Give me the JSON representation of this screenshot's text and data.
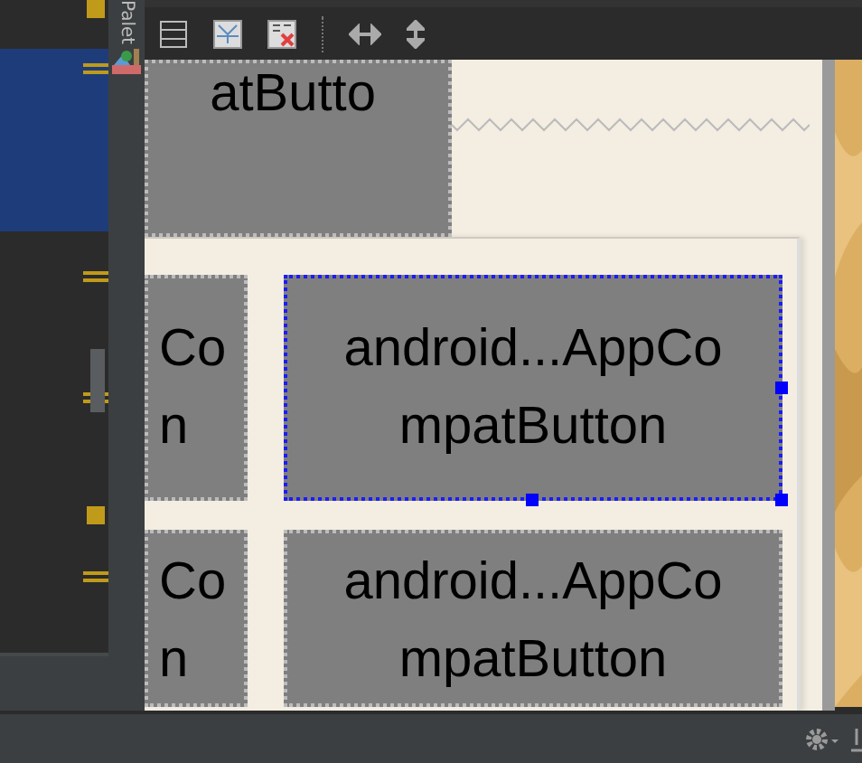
{
  "palette_tab": {
    "label": "Palet"
  },
  "canvas": {
    "top_button": {
      "text": "atButto",
      "selected": false
    },
    "rows": [
      {
        "buttons": [
          {
            "lines": [
              "Co",
              "n"
            ],
            "selected": false
          },
          {
            "lines": [
              "android...AppCo",
              "mpatButton"
            ],
            "selected": true
          }
        ]
      },
      {
        "buttons": [
          {
            "lines": [
              "Co",
              "n"
            ],
            "selected": false
          },
          {
            "lines": [
              "android...AppCo",
              "mpatButton"
            ],
            "selected": false
          }
        ]
      }
    ]
  }
}
